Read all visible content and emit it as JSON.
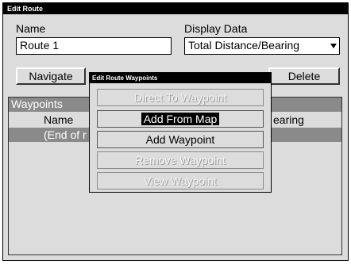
{
  "window": {
    "title": "Edit Route"
  },
  "name_label": "Name",
  "name_value": "Route 1",
  "display_label": "Display Data",
  "display_value": "Total Distance/Bearing",
  "buttons": {
    "navigate": "Navigate",
    "delete": "Delete"
  },
  "waypoints": {
    "header": "Waypoints",
    "col_name": "Name",
    "col_bearing_partial": "earing",
    "row_partial": "(End of r"
  },
  "popup": {
    "title": "Edit Route Waypoints",
    "items": [
      {
        "label": "Direct To Waypoint",
        "enabled": false
      },
      {
        "label": "Add From Map",
        "enabled": true,
        "selected": true
      },
      {
        "label": "Add Waypoint",
        "enabled": true
      },
      {
        "label": "Remove Waypoint",
        "enabled": false
      },
      {
        "label": "View Waypoint",
        "enabled": false
      }
    ]
  }
}
